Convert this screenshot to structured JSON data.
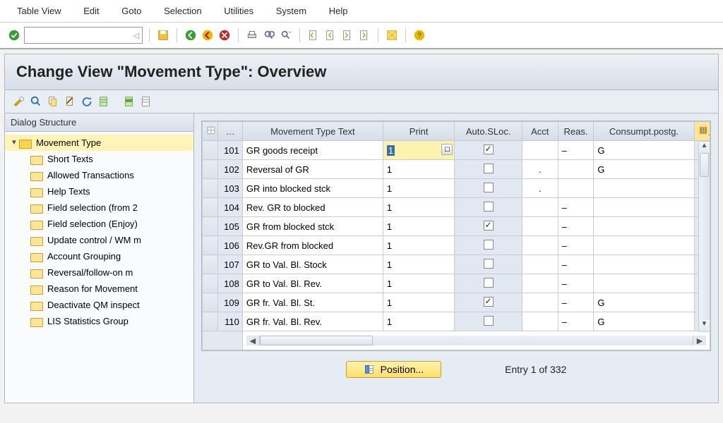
{
  "menubar": [
    "Table View",
    "Edit",
    "Goto",
    "Selection",
    "Utilities",
    "System",
    "Help"
  ],
  "header": {
    "title": "Change View \"Movement Type\": Overview"
  },
  "dialog_structure": {
    "label": "Dialog Structure",
    "root": "Movement Type",
    "children": [
      "Short Texts",
      "Allowed Transactions",
      "Help Texts",
      "Field selection (from 2",
      "Field selection (Enjoy)",
      "Update control / WM m",
      "Account Grouping",
      "Reversal/follow-on m",
      "Reason for Movement",
      "Deactivate QM inspect",
      "LIS Statistics Group"
    ]
  },
  "grid": {
    "columns": [
      "",
      "…",
      "Movement Type Text",
      "Print",
      "Auto.SLoc.",
      "Acct",
      "Reas.",
      "Consumpt.postg."
    ],
    "rows": [
      {
        "mvt": "101",
        "text": "GR goods receipt",
        "print": "1",
        "auto": true,
        "acct": "",
        "reas": "–",
        "cons": "G",
        "active": true
      },
      {
        "mvt": "102",
        "text": "Reversal of GR",
        "print": "1",
        "auto": false,
        "acct": ".",
        "reas": "",
        "cons": "G"
      },
      {
        "mvt": "103",
        "text": "GR into blocked stck",
        "print": "1",
        "auto": false,
        "acct": ".",
        "reas": "",
        "cons": ""
      },
      {
        "mvt": "104",
        "text": "Rev. GR to blocked",
        "print": "1",
        "auto": false,
        "acct": "",
        "reas": "–",
        "cons": ""
      },
      {
        "mvt": "105",
        "text": "GR from blocked stck",
        "print": "1",
        "auto": true,
        "acct": "",
        "reas": "–",
        "cons": ""
      },
      {
        "mvt": "106",
        "text": "Rev.GR from blocked",
        "print": "1",
        "auto": false,
        "acct": "",
        "reas": "–",
        "cons": ""
      },
      {
        "mvt": "107",
        "text": "GR to Val. Bl. Stock",
        "print": "1",
        "auto": false,
        "acct": "",
        "reas": "–",
        "cons": ""
      },
      {
        "mvt": "108",
        "text": "GR to Val. Bl. Rev.",
        "print": "1",
        "auto": false,
        "acct": "",
        "reas": "–",
        "cons": ""
      },
      {
        "mvt": "109",
        "text": "GR fr. Val. Bl. St.",
        "print": "1",
        "auto": true,
        "acct": "",
        "reas": "–",
        "cons": "G"
      },
      {
        "mvt": "110",
        "text": "GR fr. Val. Bl. Rev.",
        "print": "1",
        "auto": false,
        "acct": "",
        "reas": "–",
        "cons": "G"
      }
    ]
  },
  "footer": {
    "position_label": "Position...",
    "entry_text": "Entry 1 of 332"
  },
  "command_placeholder": ""
}
